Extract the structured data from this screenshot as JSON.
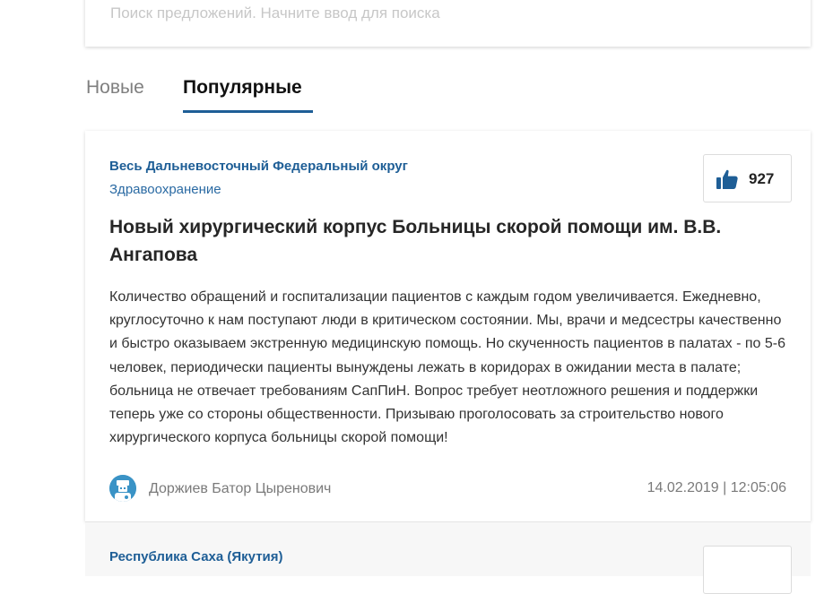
{
  "search": {
    "placeholder": "Поиск предложений. Начните ввод для поиска",
    "value": ""
  },
  "tabs": [
    {
      "label": "Новые",
      "active": false
    },
    {
      "label": "Популярные",
      "active": true
    }
  ],
  "proposals": [
    {
      "region": "Весь Дальневосточный Федеральный округ",
      "category": "Здравоохранение",
      "likes": "927",
      "like_icon": "thumbs-up-icon",
      "title": "Новый хирургический корпус Больницы скорой помощи им. В.В. Ангапова",
      "text": "Количество обращений и госпитализации пациентов с каждым годом увеличивается. Ежедневно, круглосуточно к нам поступают люди в критическом состоянии. Мы, врачи и медсестры качественно и быстро оказываем экстренную медицинскую помощь. Но скученность пациентов в палатах - по 5-6 человек, периодически пациенты вынуждены лежать в коридорах в ожидании места в палате; больница не отвечает требованиям СапПиН. Вопрос требует неотложного решения и поддержки теперь уже со стороны общественности. Призываю проголосовать за строительство нового хирургического корпуса больницы скорой помощи!",
      "author": "Доржиев Батор Цыренович",
      "date": "14.02.2019 | 12:05:06"
    },
    {
      "region": "Республика Саха (Якутия)"
    }
  ],
  "colors": {
    "accent": "#1e5e96",
    "link": "#2a6aa3",
    "avatar_bg": "#3a93c6"
  }
}
